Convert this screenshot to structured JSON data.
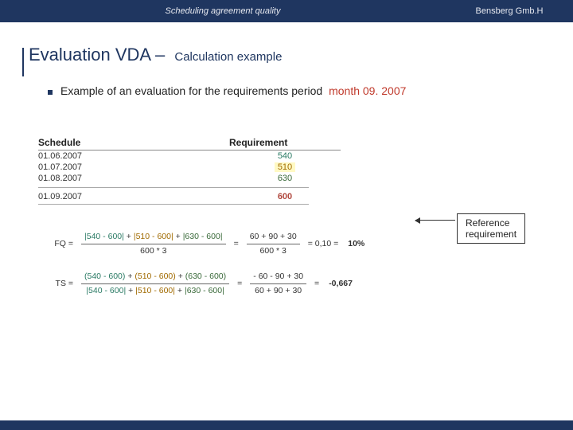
{
  "topbar": {
    "left": "Scheduling agreement quality",
    "right": "Bensberg Gmb.H"
  },
  "title": {
    "main": "Evaluation VDA –",
    "sub": "Calculation example"
  },
  "bullet": {
    "text": "Example of an evaluation for the requirements period",
    "accent": "month 09. 2007"
  },
  "table": {
    "headers": {
      "schedule": "Schedule",
      "requirement": "Requirement"
    },
    "rows": [
      {
        "date": "01.06.2007",
        "req": "540",
        "cls": "c540"
      },
      {
        "date": "01.07.2007",
        "req": "510",
        "cls": "c510"
      },
      {
        "date": "01.08.2007",
        "req": "630",
        "cls": "c630"
      }
    ],
    "ref_row": {
      "date": "01.09.2007",
      "req": "600",
      "cls": "c600"
    }
  },
  "callout": {
    "line1": "Reference",
    "line2": "requirement"
  },
  "fq": {
    "label": "FQ =",
    "num1_a": "|540 - 600|",
    "num1_b": "|510 - 600|",
    "num1_c": "|630 - 600|",
    "den1": "600 * 3",
    "num2": "60 + 90 + 30",
    "den2": "600 * 3",
    "eq_small": "= 0,10 =",
    "result": "10%"
  },
  "ts": {
    "label": "TS =",
    "num_a": "(540 - 600)",
    "num_b": "(510 - 600)",
    "num_c": "(630 - 600)",
    "den_a": "|540 - 600|",
    "den_b": "|510 - 600|",
    "den_c": "|630 - 600|",
    "num2": "- 60 - 90 + 30",
    "den2": "60 + 90 + 30",
    "eq_small": "=",
    "result": "-0,667"
  },
  "colors": {
    "brand": "#1f3660",
    "accent_red": "#b0483e"
  }
}
